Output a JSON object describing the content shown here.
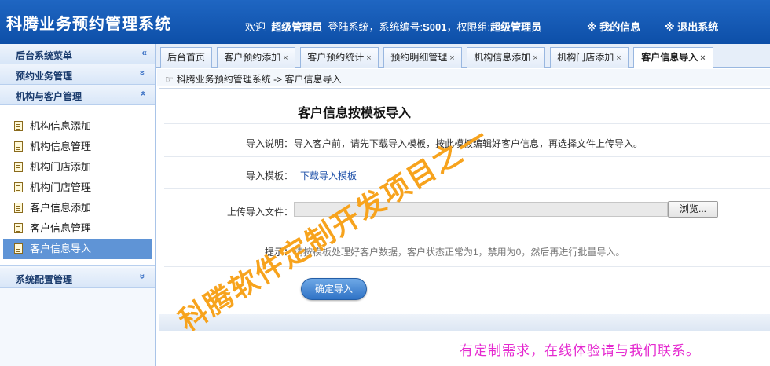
{
  "header": {
    "title": "科腾业务预约管理系统",
    "welcome_prefix": "欢迎",
    "user": "超级管理员",
    "login_text": "登陆系统，系统编号:",
    "system_no": "S001",
    "group_text": "，权限组:",
    "group": "超级管理员",
    "my_info": "※ 我的信息",
    "logout": "※ 退出系统"
  },
  "sidebar": {
    "sections": [
      {
        "label": "后台系统菜单",
        "chevron": "«"
      },
      {
        "label": "预约业务管理",
        "chevron": "»"
      },
      {
        "label": "机构与客户管理",
        "chevron": "»"
      },
      {
        "label": "系统配置管理",
        "chevron": "»"
      }
    ],
    "items": [
      {
        "label": "机构信息添加"
      },
      {
        "label": "机构信息管理"
      },
      {
        "label": "机构门店添加"
      },
      {
        "label": "机构门店管理"
      },
      {
        "label": "客户信息添加"
      },
      {
        "label": "客户信息管理"
      },
      {
        "label": "客户信息导入",
        "active": true
      }
    ]
  },
  "tabs": [
    {
      "label": "后台首页",
      "closable": false
    },
    {
      "label": "客户预约添加",
      "closable": true
    },
    {
      "label": "客户预约统计",
      "closable": true
    },
    {
      "label": "预约明细管理",
      "closable": true
    },
    {
      "label": "机构信息添加",
      "closable": true
    },
    {
      "label": "机构门店添加",
      "closable": true
    },
    {
      "label": "客户信息导入",
      "closable": true,
      "active": true
    }
  ],
  "close_glyph": "×",
  "breadcrumb": "科腾业务预约管理系统 -> 客户信息导入",
  "form": {
    "title": "客户信息按模板导入",
    "intro_label": "导入说明：",
    "intro_text": "导入客户前，请先下载导入模板，按此模板编辑好客户信息，再选择文件上传导入。",
    "template_label": "导入模板：",
    "template_link": "下载导入模板",
    "file_label": "上传导入文件：",
    "browse": "浏览...",
    "hint_label": "提示：",
    "hint_text": "请按模板处理好客户数据，客户状态正常为1，禁用为0，然后再进行批量导入。",
    "submit": "确定导入"
  },
  "watermark": "科腾软件定制开发项目之一",
  "contact": "有定制需求，在线体验请与我们联系。"
}
